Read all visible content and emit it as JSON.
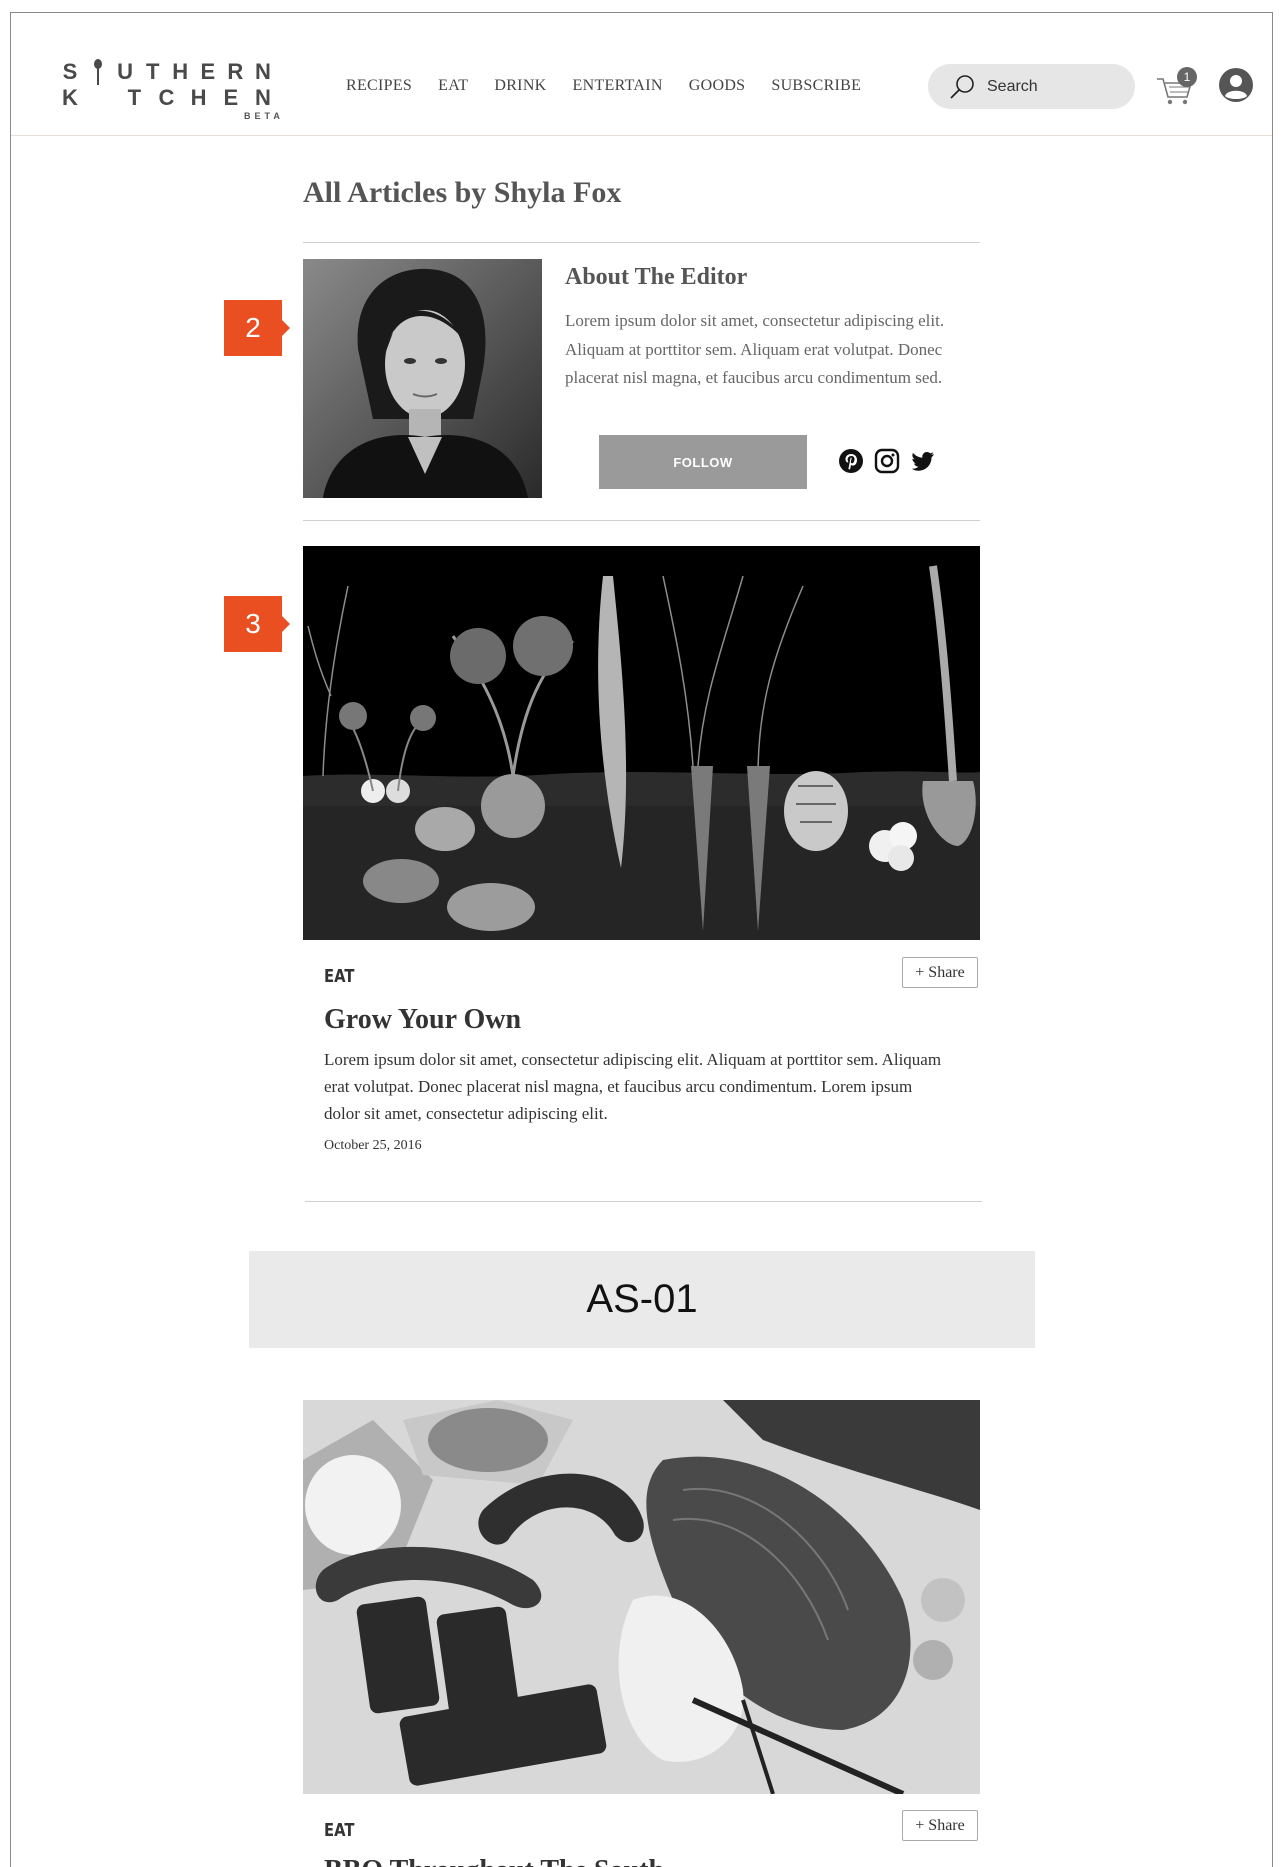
{
  "logo": {
    "row1": [
      "S",
      "",
      "U",
      "T",
      "H",
      "E",
      "R",
      "N"
    ],
    "row2": [
      "K",
      "",
      "T",
      "C",
      "H",
      "E",
      "N"
    ],
    "badge": "BETA"
  },
  "nav": {
    "items": [
      "RECIPES",
      "EAT",
      "DRINK",
      "ENTERTAIN",
      "GOODS",
      "SUBSCRIBE"
    ]
  },
  "search": {
    "label": "Search"
  },
  "cart": {
    "count": "1"
  },
  "page": {
    "title": "All Articles by Shyla Fox"
  },
  "editor": {
    "heading": "About The Editor",
    "bio": "Lorem ipsum dolor sit amet, consectetur adipiscing elit. Aliquam at porttitor sem.  Aliquam erat volutpat. Donec placerat nisl magna, et faucibus arcu condimentum sed.",
    "follow_label": "FOLLOW",
    "social": [
      "pinterest-icon",
      "instagram-icon",
      "twitter-icon"
    ]
  },
  "callouts": [
    "2",
    "3"
  ],
  "articles": [
    {
      "category": "EAT",
      "title": "Grow Your Own",
      "excerpt": "Lorem ipsum dolor sit amet, consectetur adipiscing elit. Aliquam at porttitor sem. Aliquam erat volutpat. Donec placerat nisl magna, et faucibus arcu condimentum. Lorem ipsum dolor sit amet, consectetur adipiscing elit.",
      "date": "October 25, 2016",
      "share_label": "+ Share"
    },
    {
      "category": "EAT",
      "title": "BBQ Throughout The South",
      "share_label": "+ Share"
    }
  ],
  "ad": {
    "label": "AS-01"
  },
  "colors": {
    "accent": "#ea4f22",
    "follow_bg": "#9a9a9a",
    "search_bg": "#e6e6e6"
  }
}
